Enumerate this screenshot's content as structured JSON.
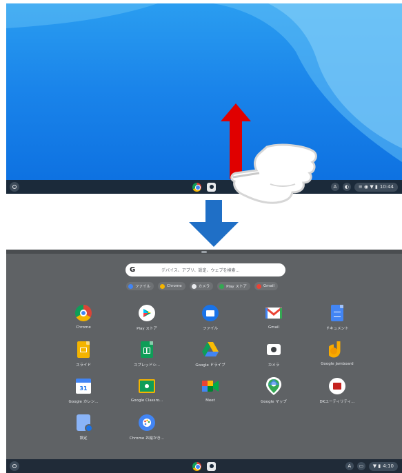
{
  "top_screen": {
    "shelf": {
      "apps": [
        {
          "name": "chrome-icon"
        },
        {
          "name": "camera-icon"
        }
      ],
      "tray": {
        "icon_a": "A",
        "icon_b": "◐",
        "status_icons": "≡ ◉ ▼ ▮",
        "time": "10:44"
      }
    }
  },
  "launcher": {
    "search": {
      "logo": "G",
      "placeholder": "デバイス、アプリ、設定、ウェブを検索..."
    },
    "chips": [
      {
        "label": "ファイル",
        "color": "#4285f4"
      },
      {
        "label": "Chrome",
        "color": "#f4b400"
      },
      {
        "label": "カメラ",
        "color": "#e8eaed"
      },
      {
        "label": "Play ストア",
        "color": "#34a853"
      },
      {
        "label": "Gmail",
        "color": "#ea4335"
      }
    ],
    "apps": [
      {
        "label": "Chrome",
        "icon": "chrome"
      },
      {
        "label": "Play ストア",
        "icon": "play"
      },
      {
        "label": "ファイル",
        "icon": "files"
      },
      {
        "label": "Gmail",
        "icon": "gmail"
      },
      {
        "label": "ドキュメント",
        "icon": "docs"
      },
      {
        "label": "スライド",
        "icon": "slides"
      },
      {
        "label": "スプレッドシ...",
        "icon": "sheets"
      },
      {
        "label": "Google ドライブ",
        "icon": "drive"
      },
      {
        "label": "カメラ",
        "icon": "camera"
      },
      {
        "label": "Google Jamboard",
        "icon": "jamboard"
      },
      {
        "label": "Google カレン...",
        "icon": "calendar"
      },
      {
        "label": "Google Classro...",
        "icon": "classroom"
      },
      {
        "label": "Meet",
        "icon": "meet"
      },
      {
        "label": "Google マップ",
        "icon": "maps"
      },
      {
        "label": "DKユーティリティ...",
        "icon": "dk"
      },
      {
        "label": "設定",
        "icon": "settings"
      },
      {
        "label": "Chrome お絵かき...",
        "icon": "canvas"
      }
    ]
  },
  "bottom_shelf": {
    "tray": {
      "icon_a": "A",
      "icon_b": "▭",
      "status_icons": "▼ ▮",
      "time": "4:10"
    }
  },
  "colors": {
    "wallpaper": "#1a84ea",
    "launcher_bg": "#5f6265",
    "shelf": "#1b2a3a",
    "arrow_up": "#e00000",
    "arrow_down": "#1f6fc6"
  }
}
